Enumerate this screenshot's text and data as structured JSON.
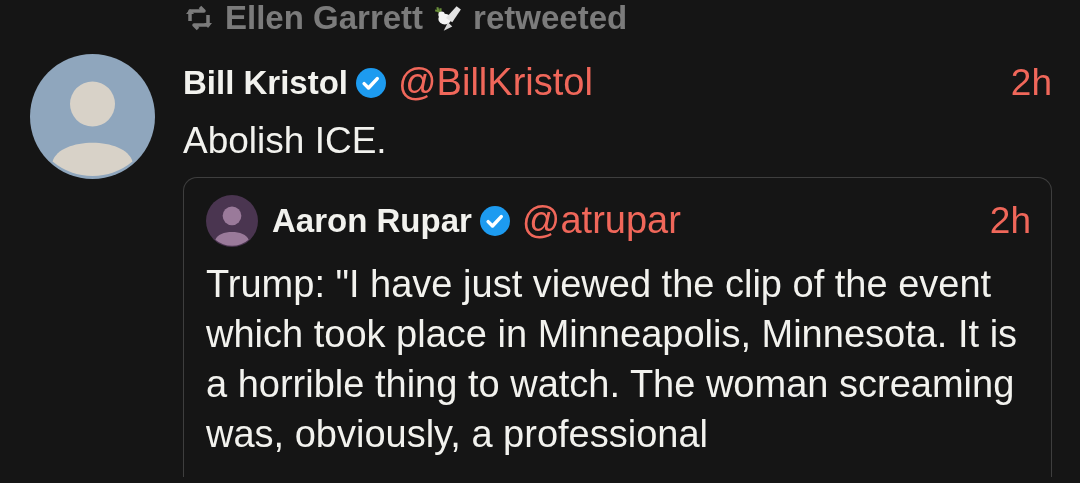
{
  "retweet": {
    "user": "Ellen Garrett",
    "action": "retweeted"
  },
  "tweet": {
    "name": "Bill Kristol",
    "verified": true,
    "handle": "@BillKristol",
    "time": "2h",
    "text": "Abolish ICE.",
    "quote": {
      "name": "Aaron Rupar",
      "verified": true,
      "handle": "@atrupar",
      "time": "2h",
      "text": "Trump: \"I have just viewed the clip of the event which took place in Minneapolis, Minnesota. It is a horrible thing to watch. The woman screaming was, obviously, a professional"
    }
  }
}
